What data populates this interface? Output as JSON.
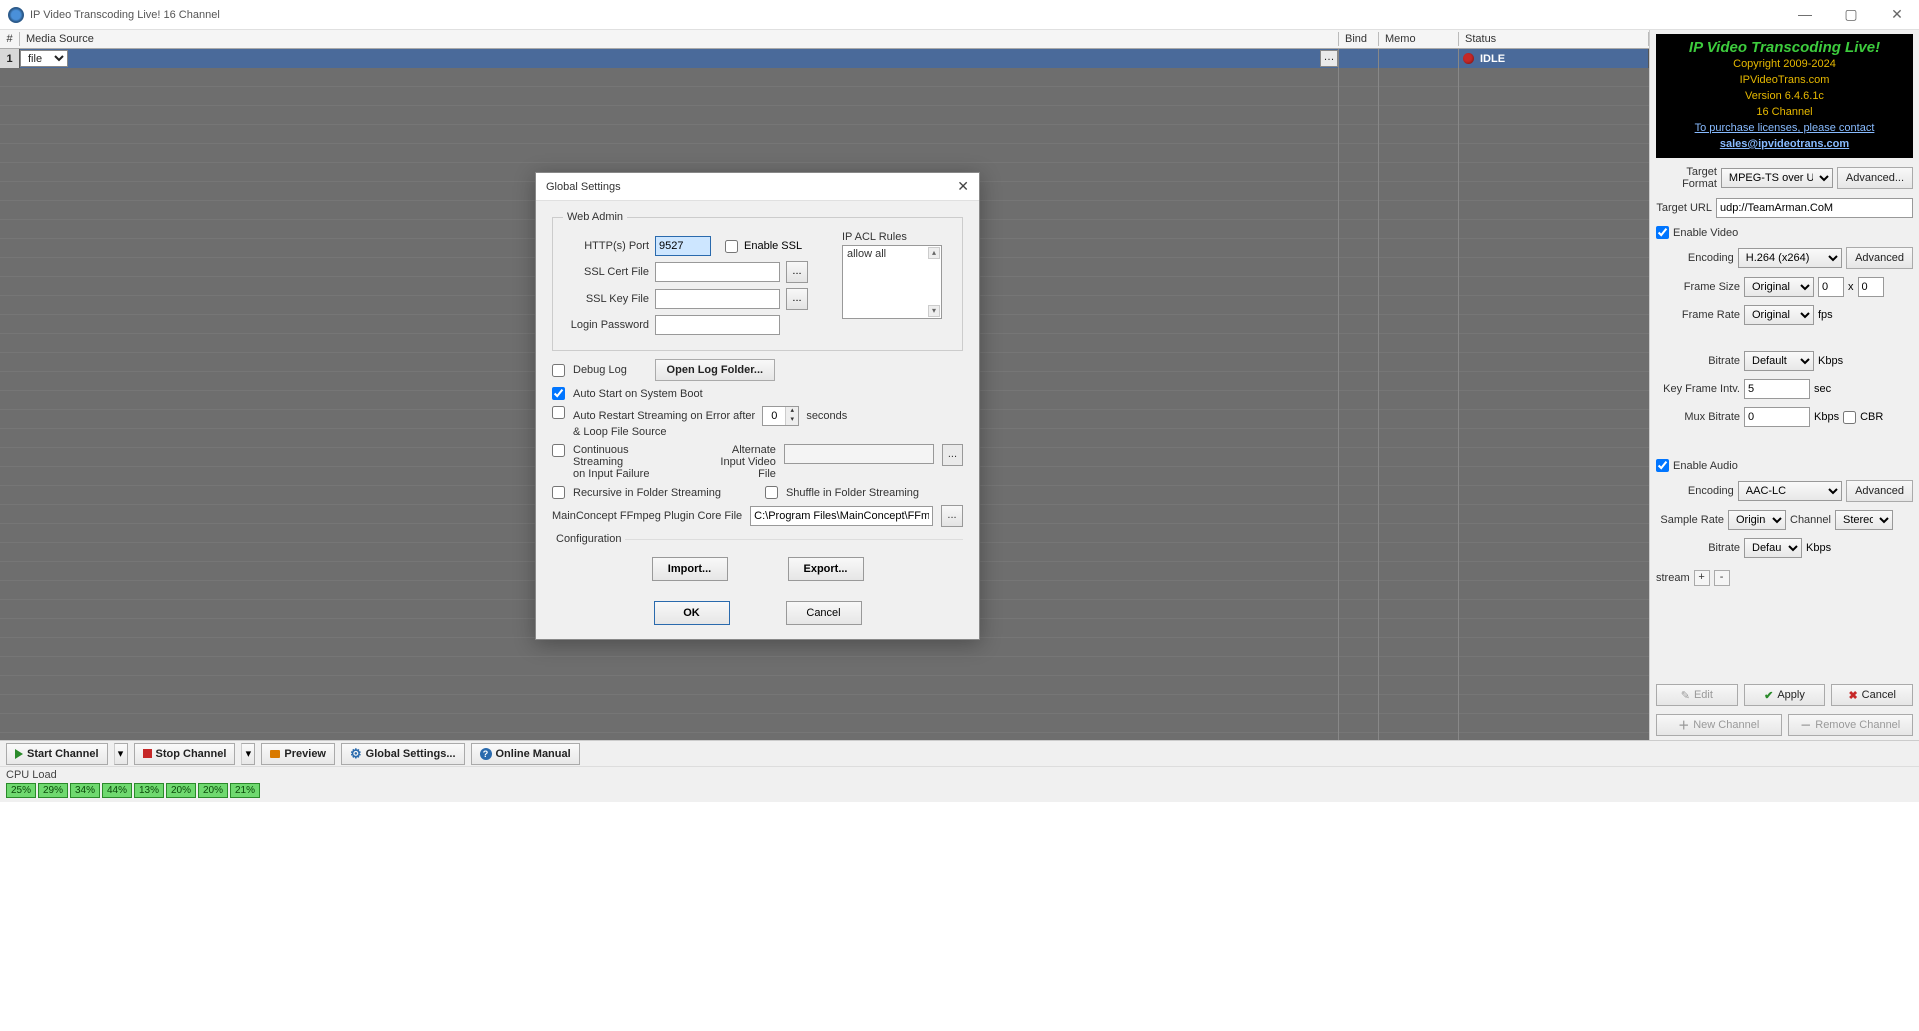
{
  "app": {
    "title": "IP Video Transcoding Live! 16 Channel"
  },
  "grid": {
    "headers": {
      "num": "#",
      "media": "Media Source",
      "bind": "Bind",
      "memo": "Memo",
      "status": "Status"
    },
    "rows": [
      {
        "num": "1",
        "media_type": "file",
        "status": "IDLE"
      }
    ]
  },
  "promo": {
    "line1": "IP Video Transcoding Live!",
    "copyright": "Copyright 2009-2024",
    "site": "IPVideoTrans.com",
    "version": "Version 6.4.6.1c",
    "channels": "16 Channel",
    "contact_pre": "To purchase licenses, please contact",
    "contact_email": "sales@ipvideotrans.com"
  },
  "right": {
    "target_format_lbl": "Target Format",
    "target_format_val": "MPEG-TS over UDP",
    "advanced_btn": "Advanced...",
    "target_url_lbl": "Target URL",
    "target_url_val": "udp://TeamArman.CoM",
    "enable_video_lbl": "Enable Video",
    "v_encoding_lbl": "Encoding",
    "v_encoding_val": "H.264 (x264)",
    "v_adv_btn": "Advanced",
    "frame_size_lbl": "Frame Size",
    "frame_size_val": "Original",
    "fs_w": "0",
    "fs_x": "x",
    "fs_h": "0",
    "frame_rate_lbl": "Frame Rate",
    "frame_rate_val": "Original",
    "fps_unit": "fps",
    "bitrate_lbl": "Bitrate",
    "bitrate_val": "Default",
    "bitrate_unit": "Kbps",
    "keyframe_lbl": "Key Frame Intv.",
    "keyframe_val": "5",
    "keyframe_unit": "sec",
    "mux_lbl": "Mux Bitrate",
    "mux_val": "0",
    "mux_unit": "Kbps",
    "cbr_lbl": "CBR",
    "enable_audio_lbl": "Enable Audio",
    "a_encoding_lbl": "Encoding",
    "a_encoding_val": "AAC-LC",
    "a_adv_btn": "Advanced",
    "sample_rate_lbl": "Sample Rate",
    "sample_rate_val": "Original",
    "channel_lbl": "Channel",
    "channel_val": "Stereo",
    "a_bitrate_lbl": "Bitrate",
    "a_bitrate_val": "Default",
    "a_bitrate_unit": "Kbps",
    "stream_lbl": "stream",
    "edit_btn": "Edit",
    "apply_btn": "Apply",
    "cancel_btn": "Cancel",
    "new_ch_btn": "New Channel",
    "rem_ch_btn": "Remove Channel"
  },
  "toolbar": {
    "start": "Start Channel",
    "stop": "Stop Channel",
    "preview": "Preview",
    "global": "Global Settings...",
    "manual": "Online Manual"
  },
  "cpu": {
    "label": "CPU Load",
    "values": [
      "25%",
      "29%",
      "34%",
      "44%",
      "13%",
      "20%",
      "20%",
      "21%"
    ]
  },
  "dialog": {
    "title": "Global Settings",
    "webadmin_legend": "Web Admin",
    "http_port_lbl": "HTTP(s) Port",
    "http_port_val": "9527",
    "enable_ssl_lbl": "Enable SSL",
    "ssl_cert_lbl": "SSL Cert File",
    "ssl_cert_val": "",
    "ssl_key_lbl": "SSL Key File",
    "ssl_key_val": "",
    "login_pw_lbl": "Login Password",
    "login_pw_val": "",
    "acl_lbl": "IP ACL Rules",
    "acl_item": "allow all",
    "debug_log_lbl": "Debug Log",
    "open_log_btn": "Open Log Folder...",
    "autostart_lbl": "Auto Start on System Boot",
    "autorestart_lbl_1": "Auto Restart Streaming on Error after",
    "autorestart_lbl_2": "& Loop File Source",
    "autorestart_val": "0",
    "autorestart_unit": "seconds",
    "cont_lbl_1": "Continuous Streaming",
    "cont_lbl_2": "on Input Failure",
    "alt_lbl_1": "Alternate",
    "alt_lbl_2": "Input Video File",
    "alt_val": "",
    "recursive_lbl": "Recursive in Folder Streaming",
    "shuffle_lbl": "Shuffle in Folder Streaming",
    "mainconcept_lbl": "MainConcept FFmpeg Plugin Core File",
    "mainconcept_val": "C:\\Program Files\\MainConcept\\FFmpeg-Pl",
    "config_legend": "Configuration",
    "import_btn": "Import...",
    "export_btn": "Export...",
    "ok_btn": "OK",
    "cancel_btn": "Cancel"
  }
}
